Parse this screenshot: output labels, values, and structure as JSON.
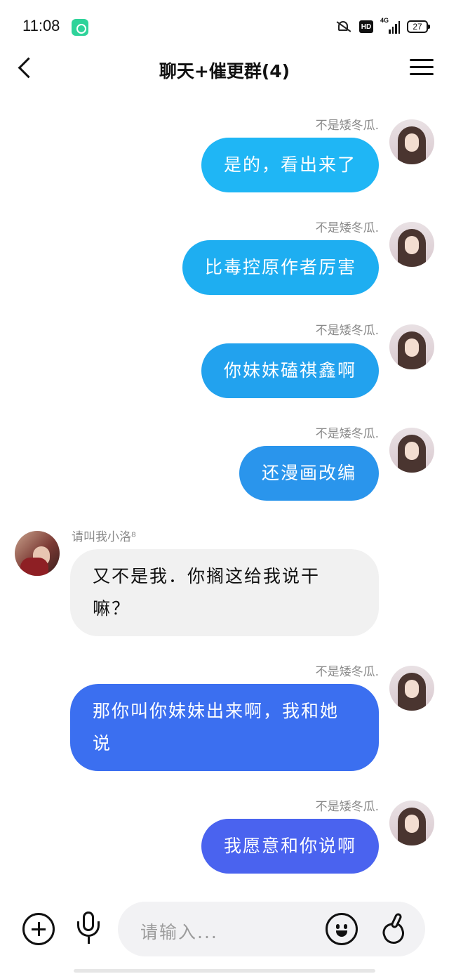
{
  "status_bar": {
    "time": "11:08",
    "network": "4G",
    "hd": "HD",
    "battery": "27"
  },
  "header": {
    "title": "聊天+催更群(4)"
  },
  "messages": [
    {
      "side": "right",
      "sender": "不是矮冬瓜.",
      "text": "是的，看出来了",
      "color": "#1fb6f5"
    },
    {
      "side": "right",
      "sender": "不是矮冬瓜.",
      "text": "比毒控原作者厉害",
      "color": "#1eaef1"
    },
    {
      "side": "right",
      "sender": "不是矮冬瓜.",
      "text": "你妹妹磕祺鑫啊",
      "color": "#22a2ee"
    },
    {
      "side": "right",
      "sender": "不是矮冬瓜.",
      "text": "还漫画改编",
      "color": "#2a95ec"
    },
    {
      "side": "left",
      "sender": "请叫我小洛⁸",
      "text": "又不是我．你搁这给我说干嘛？",
      "color": "#f1f1f1"
    },
    {
      "side": "right",
      "sender": "不是矮冬瓜.",
      "text": "那你叫你妹妹出来啊，我和她说",
      "color": "#3b6ff0"
    },
    {
      "side": "right",
      "sender": "不是矮冬瓜.",
      "text": "我愿意和你说啊",
      "color": "#4a63ef"
    }
  ],
  "input_bar": {
    "placeholder": "请输入..."
  },
  "icons": {
    "back": "back-arrow-icon",
    "menu": "menu-icon",
    "plus": "plus-icon",
    "mic": "microphone-icon",
    "emoji": "emoji-icon",
    "gesture": "hand-gesture-icon"
  }
}
